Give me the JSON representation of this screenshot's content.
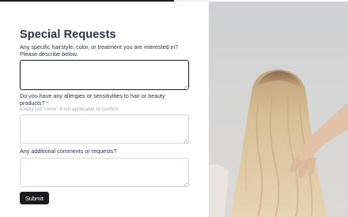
{
  "progress": {
    "fraction": 0.5
  },
  "form": {
    "title": "Special Requests",
    "question1": {
      "label": "Any specific hairstyle, color, or treatment you are interested in? Please describe below.",
      "value": ""
    },
    "question2": {
      "label": "Do you have any allergies or sensitivities to hair or beauty products?",
      "required_mark": "*",
      "hint": "Kindly put \"none\" if not applicable to confirm.",
      "value": ""
    },
    "question3": {
      "label": "Any additional comments or requests?",
      "value": ""
    },
    "submit_label": "Submit"
  },
  "side_image": {
    "subject": "woman-with-long-blonde-wavy-hair-from-behind"
  },
  "colors": {
    "accent": "#1c1c1e",
    "required": "#e0533f",
    "background": "#ffffff"
  }
}
